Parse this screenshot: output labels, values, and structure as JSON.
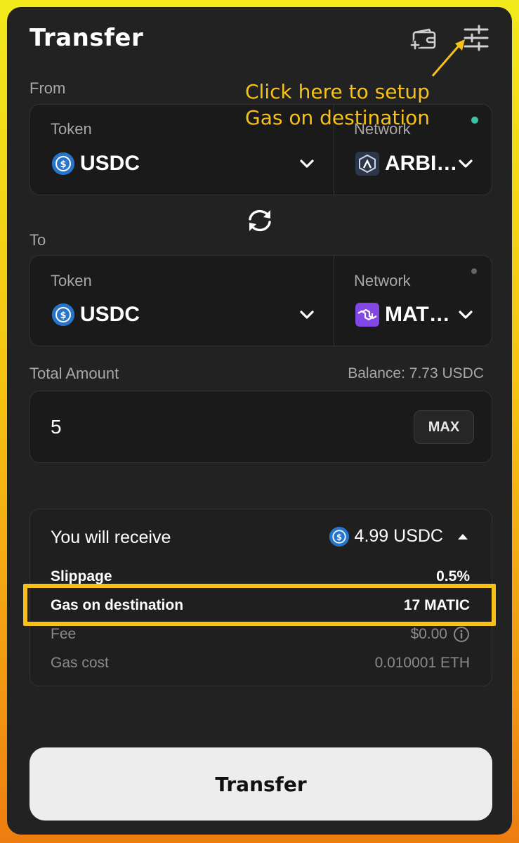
{
  "header": {
    "title": "Transfer",
    "wallet_icon": "add-wallet-icon",
    "settings_icon": "sliders-icon"
  },
  "from": {
    "label": "From",
    "token_label": "Token",
    "token_value": "USDC",
    "network_label": "Network",
    "network_value": "ARBI…",
    "status_color": "#3fc1a5"
  },
  "to": {
    "label": "To",
    "token_label": "Token",
    "token_value": "USDC",
    "network_label": "Network",
    "network_value": "MAT…",
    "status_color": "#666666"
  },
  "amount": {
    "label": "Total Amount",
    "balance": "Balance: 7.73 USDC",
    "value": "5",
    "max_label": "MAX"
  },
  "receive": {
    "title": "You will receive",
    "value": "4.99 USDC",
    "rows": [
      {
        "label": "Slippage",
        "value": "0.5%"
      },
      {
        "label": "Gas on destination",
        "value": "17 MATIC"
      },
      {
        "label": "Fee",
        "value": "$0.00"
      },
      {
        "label": "Gas cost",
        "value": "0.010001 ETH"
      }
    ]
  },
  "annotation": {
    "line1": "Click here to setup",
    "line2": "Gas on destination"
  },
  "submit_label": "Transfer",
  "colors": {
    "accent": "#f6c21a",
    "usdc": "#2775ca",
    "polygon": "#8247e5",
    "arbitrum": "#2d374b"
  }
}
